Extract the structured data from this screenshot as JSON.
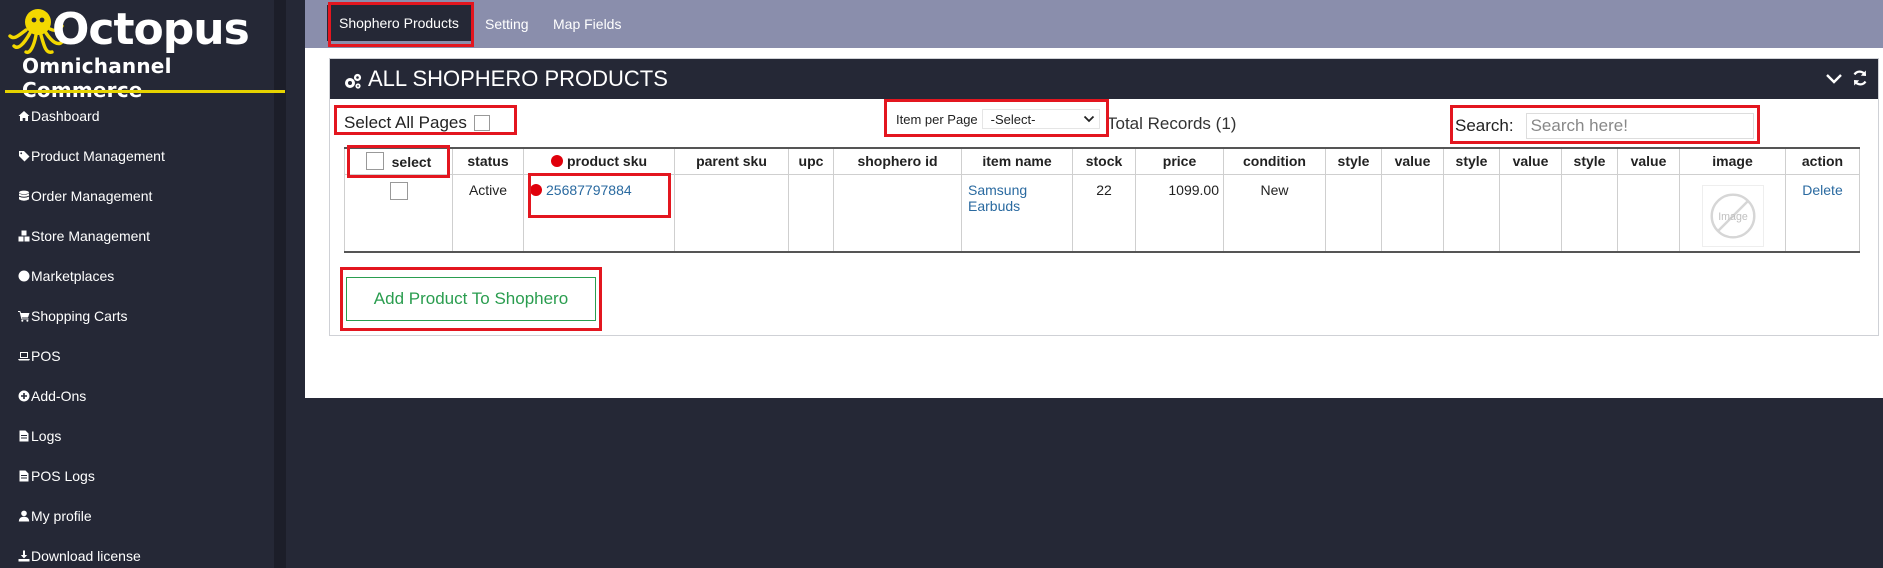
{
  "colors": {
    "accent_red": "#e3161f",
    "sidebar_bg": "#252836",
    "topbar_bg": "#8a8eac",
    "link_blue": "#2a6aa0",
    "button_green": "#2a9d4f",
    "logo_rule": "#e6d300"
  },
  "logo": {
    "brand": "Octopus",
    "tagline": "Omnichannel Commerce"
  },
  "sidebar": {
    "items": [
      {
        "label": "Dashboard",
        "icon": "home-icon"
      },
      {
        "label": "Product Management",
        "icon": "tag-icon"
      },
      {
        "label": "Order Management",
        "icon": "database-icon"
      },
      {
        "label": "Store Management",
        "icon": "cubes-icon"
      },
      {
        "label": "Marketplaces",
        "icon": "globe-icon"
      },
      {
        "label": "Shopping Carts",
        "icon": "cart-icon"
      },
      {
        "label": "POS",
        "icon": "laptop-icon"
      },
      {
        "label": "Add-Ons",
        "icon": "plus-circle-icon"
      },
      {
        "label": "Logs",
        "icon": "file-icon"
      },
      {
        "label": "POS Logs",
        "icon": "file-icon"
      },
      {
        "label": "My profile",
        "icon": "user-icon"
      },
      {
        "label": "Download license",
        "icon": "download-icon"
      }
    ]
  },
  "tabs": {
    "active": "Shophero Products",
    "setting": "Setting",
    "map_fields": "Map Fields"
  },
  "panel": {
    "title": "ALL SHOPHERO PRODUCTS",
    "select_all_label": "Select All Pages",
    "item_per_page_label": "Item per Page",
    "item_per_page_value": "-Select-",
    "total_records": "Total Records (1)",
    "search_label": "Search:",
    "search_placeholder": "Search here!",
    "add_button": "Add Product To Shophero"
  },
  "table": {
    "headers": [
      "select",
      "status",
      "product sku",
      "parent sku",
      "upc",
      "shophero id",
      "item name",
      "stock",
      "price",
      "condition",
      "style",
      "value",
      "style",
      "value",
      "style",
      "value",
      "image",
      "action"
    ],
    "rows": [
      {
        "status": "Active",
        "product_sku": "25687797884",
        "parent_sku": "",
        "upc": "",
        "shophero_id": "",
        "item_name": "Samsung Earbuds",
        "stock": "22",
        "price": "1099.00",
        "condition": "New",
        "style1": "",
        "value1": "",
        "style2": "",
        "value2": "",
        "style3": "",
        "value3": "",
        "image_alt": "Image",
        "action": "Delete"
      }
    ]
  }
}
